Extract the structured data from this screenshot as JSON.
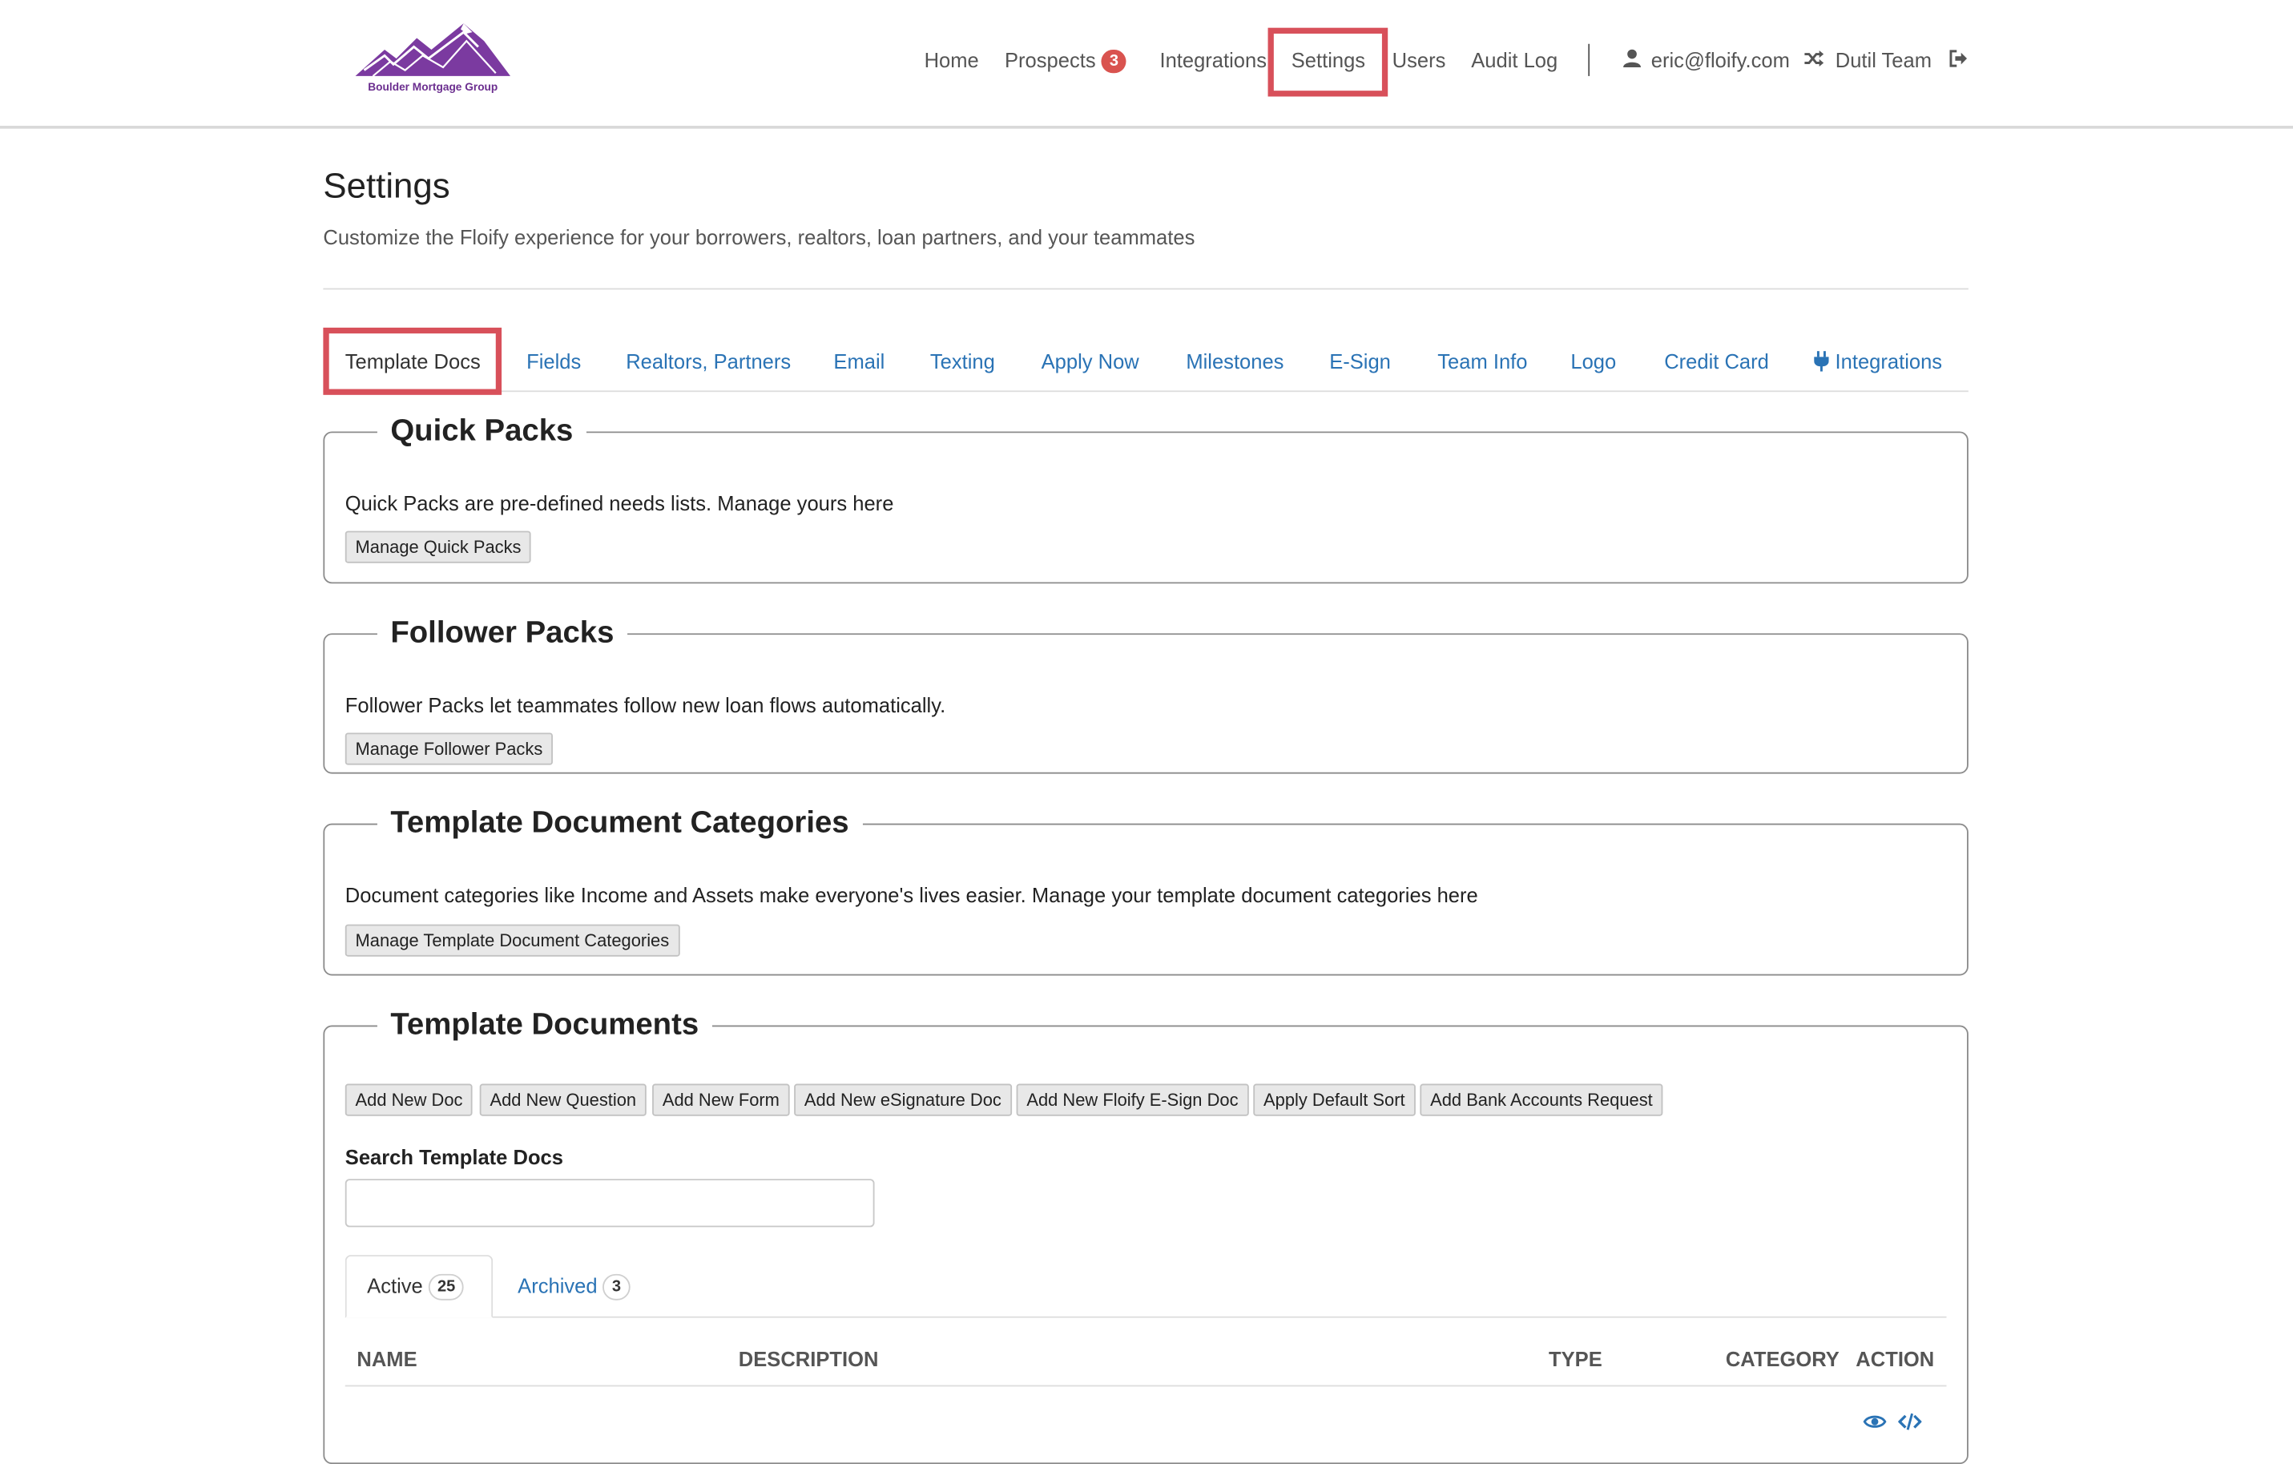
{
  "brand": {
    "logo_caption": "Boulder Mortgage Group",
    "logo_color": "#7b3aa0"
  },
  "nav": {
    "home": "Home",
    "prospects": "Prospects",
    "prospects_count": "3",
    "integrations": "Integrations",
    "settings": "Settings",
    "users": "Users",
    "audit_log": "Audit Log",
    "user_email": "eric@floify.com",
    "team": "Dutil Team"
  },
  "page": {
    "title": "Settings",
    "subtitle": "Customize the Floify experience for your borrowers, realtors, loan partners, and your teammates"
  },
  "tabs": [
    "Template Docs",
    "Fields",
    "Realtors, Partners",
    "Email",
    "Texting",
    "Apply Now",
    "Milestones",
    "E-Sign",
    "Team Info",
    "Logo",
    "Credit Card",
    "Integrations"
  ],
  "active_tab": "Template Docs",
  "sections": {
    "quick_packs": {
      "title": "Quick Packs",
      "text": "Quick Packs are pre-defined needs lists. Manage yours here",
      "button": "Manage Quick Packs"
    },
    "follower_packs": {
      "title": "Follower Packs",
      "text": "Follower Packs let teammates follow new loan flows automatically.",
      "button": "Manage Follower Packs"
    },
    "categories": {
      "title": "Template Document Categories",
      "text": "Document categories like Income and Assets make everyone's lives easier. Manage your template document categories here",
      "button": "Manage Template Document Categories"
    },
    "template_documents": {
      "title": "Template Documents",
      "buttons": [
        "Add New Doc",
        "Add New Question",
        "Add New Form",
        "Add New eSignature Doc",
        "Add New Floify E-Sign Doc",
        "Apply Default Sort",
        "Add Bank Accounts Request"
      ],
      "search_label": "Search Template Docs",
      "search_value": "",
      "subtabs": {
        "active_label": "Active",
        "active_count": "25",
        "archived_label": "Archived",
        "archived_count": "3"
      },
      "columns": [
        "NAME",
        "DESCRIPTION",
        "TYPE",
        "CATEGORY",
        "ACTION"
      ]
    }
  },
  "colors": {
    "link": "#2a73b5",
    "highlight": "#d8505a",
    "badge": "#d9534f"
  }
}
